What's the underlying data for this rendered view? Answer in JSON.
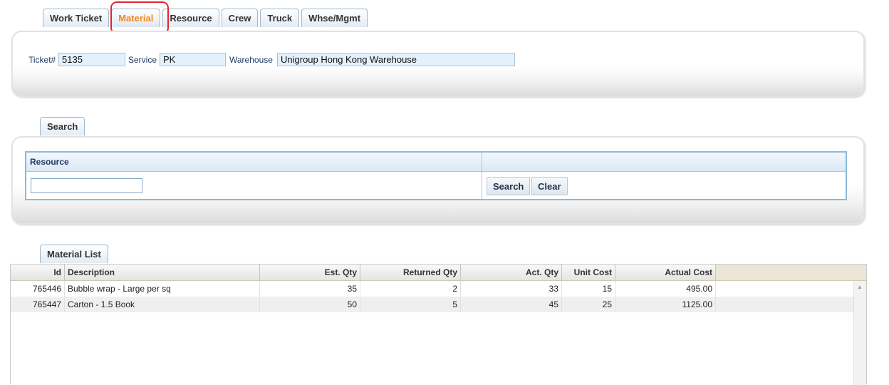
{
  "tabs": [
    {
      "label": "Work Ticket",
      "active": false
    },
    {
      "label": "Material",
      "active": true
    },
    {
      "label": "Resource",
      "active": false
    },
    {
      "label": "Crew",
      "active": false
    },
    {
      "label": "Truck",
      "active": false
    },
    {
      "label": "Whse/Mgmt",
      "active": false
    }
  ],
  "header": {
    "ticket_label": "Ticket#",
    "ticket_value": "5135",
    "service_label": "Service",
    "service_value": "PK",
    "warehouse_label": "Warehouse",
    "warehouse_value": "Unigroup Hong Kong Warehouse"
  },
  "search": {
    "tab_label": "Search",
    "column_label": "Resource",
    "input_value": "",
    "search_button": "Search",
    "clear_button": "Clear"
  },
  "material_list": {
    "tab_label": "Material List",
    "columns": [
      "Id",
      "Description",
      "Est. Qty",
      "Returned Qty",
      "Act. Qty",
      "Unit Cost",
      "Actual Cost"
    ],
    "rows": [
      [
        "765446",
        "Bubble wrap - Large per sq",
        "35",
        "2",
        "33",
        "15",
        "495.00"
      ],
      [
        "765447",
        "Carton - 1.5 Book",
        "50",
        "5",
        "45",
        "25",
        "1125.00"
      ]
    ]
  },
  "colors": {
    "active_tab_text": "#f08a24",
    "highlight_ring": "#e0262b",
    "field_bg": "#e4f0fb",
    "grid_border": "#8bbad8"
  }
}
